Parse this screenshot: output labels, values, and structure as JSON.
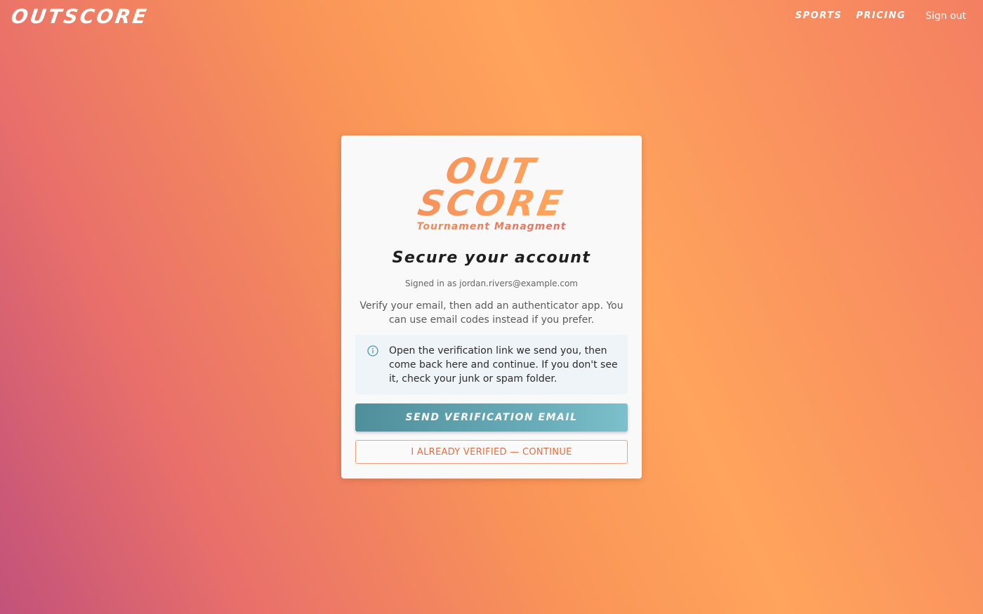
{
  "header": {
    "brand": "OUTSCORE",
    "nav": {
      "sports": "SPORTS",
      "pricing": "PRICING",
      "sign_out": "Sign out"
    }
  },
  "card": {
    "logo": {
      "line1": "OUT",
      "line2": "SCORE",
      "tagline": "Tournament Managment"
    },
    "heading": "Secure your account",
    "signed_in": "Signed in as jordan.rivers@example.com",
    "intro": "Verify your email, then add an authenticator app. You can use email codes instead if you prefer.",
    "info": {
      "icon": "info-circle-icon",
      "text": "Open the verification link we send you, then come back here and continue. If you don't see it, check your junk or spam folder."
    },
    "primary_button": "SEND VERIFICATION EMAIL",
    "secondary_button": "I ALREADY VERIFIED — CONTINUE"
  },
  "colors": {
    "accent_teal": "#5fa3ae",
    "accent_orange": "#ffa45c",
    "secondary_text": "#e86c3c"
  }
}
